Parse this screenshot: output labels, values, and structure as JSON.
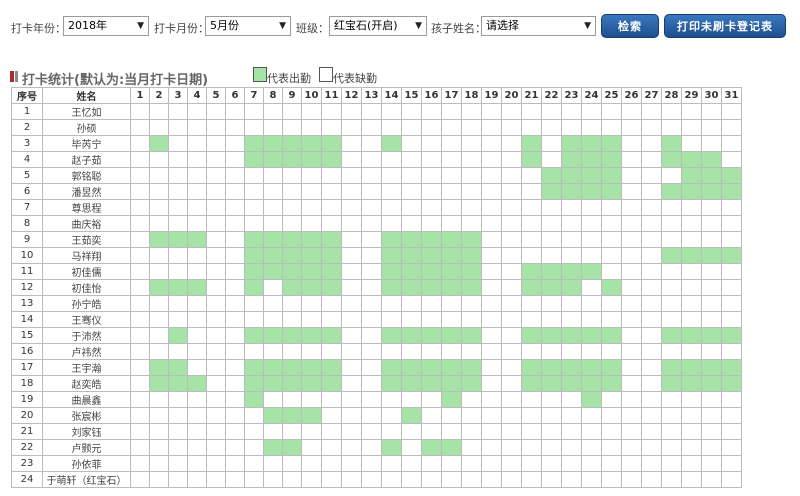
{
  "filters": {
    "year_label": "打卡年份：",
    "year_value": "2018年",
    "month_label": "打卡月份：",
    "month_value": "5月份",
    "class_label": "班级：",
    "class_value": "红宝石(开启)",
    "child_label": "孩子姓名：",
    "child_value": "请选择",
    "dropdown_arrow": "▼"
  },
  "buttons": {
    "search": "检索",
    "print": "打印未刷卡登记表"
  },
  "section": {
    "title": "打卡统计(默认为:当月打卡日期)"
  },
  "legend": {
    "present": "代表出勤",
    "absent": "代表缺勤",
    "present_color": "#a6e3a6",
    "absent_color": "#ffffff"
  },
  "table": {
    "headers": {
      "index": "序号",
      "name": "姓名"
    },
    "days": [
      "1",
      "2",
      "3",
      "4",
      "5",
      "6",
      "7",
      "8",
      "9",
      "10",
      "11",
      "12",
      "13",
      "14",
      "15",
      "16",
      "17",
      "18",
      "19",
      "20",
      "21",
      "22",
      "23",
      "24",
      "25",
      "26",
      "27",
      "28",
      "29",
      "30",
      "31"
    ],
    "rows": [
      {
        "no": "1",
        "name": "王忆如",
        "present": []
      },
      {
        "no": "2",
        "name": "孙硕",
        "present": []
      },
      {
        "no": "3",
        "name": "毕芮宁",
        "present": [
          2,
          7,
          8,
          9,
          10,
          11,
          14,
          21,
          23,
          24,
          25,
          28
        ]
      },
      {
        "no": "4",
        "name": "赵子茹",
        "present": [
          7,
          8,
          9,
          10,
          11,
          21,
          23,
          24,
          25,
          28,
          29,
          30
        ]
      },
      {
        "no": "5",
        "name": "郭铭聪",
        "present": [
          22,
          23,
          24,
          25,
          29,
          30,
          31
        ]
      },
      {
        "no": "6",
        "name": "潘昱然",
        "present": [
          22,
          23,
          24,
          25,
          28,
          29,
          30,
          31
        ]
      },
      {
        "no": "7",
        "name": "尊思程",
        "present": []
      },
      {
        "no": "8",
        "name": "曲庆裕",
        "present": []
      },
      {
        "no": "9",
        "name": "王茹奕",
        "present": [
          2,
          3,
          4,
          7,
          8,
          9,
          10,
          11,
          14,
          15,
          16,
          17,
          18
        ]
      },
      {
        "no": "10",
        "name": "马祥翔",
        "present": [
          7,
          8,
          9,
          10,
          11,
          14,
          15,
          16,
          17,
          18,
          28,
          29,
          30,
          31
        ]
      },
      {
        "no": "11",
        "name": "初佳儒",
        "present": [
          7,
          8,
          9,
          10,
          11,
          14,
          15,
          16,
          17,
          18,
          21,
          22,
          23,
          24
        ]
      },
      {
        "no": "12",
        "name": "初佳怡",
        "present": [
          2,
          3,
          4,
          7,
          9,
          10,
          11,
          14,
          15,
          16,
          17,
          18,
          21,
          22,
          23,
          25
        ]
      },
      {
        "no": "13",
        "name": "孙宁皓",
        "present": []
      },
      {
        "no": "14",
        "name": "王骞仪",
        "present": []
      },
      {
        "no": "15",
        "name": "于沛然",
        "present": [
          3,
          7,
          8,
          9,
          10,
          11,
          14,
          15,
          16,
          17,
          18,
          21,
          22,
          23,
          24,
          25,
          28,
          29,
          30,
          31
        ]
      },
      {
        "no": "16",
        "name": "卢祎然",
        "present": []
      },
      {
        "no": "17",
        "name": "王宇瀚",
        "present": [
          2,
          3,
          7,
          8,
          9,
          10,
          11,
          14,
          15,
          16,
          17,
          18,
          21,
          22,
          23,
          24,
          25,
          28,
          29,
          30,
          31
        ]
      },
      {
        "no": "18",
        "name": "赵奕皓",
        "present": [
          2,
          3,
          4,
          7,
          8,
          9,
          10,
          11,
          14,
          15,
          16,
          17,
          18,
          21,
          22,
          23,
          24,
          25,
          28,
          29,
          30,
          31
        ]
      },
      {
        "no": "19",
        "name": "曲晨鑫",
        "present": [
          7,
          17,
          24
        ]
      },
      {
        "no": "20",
        "name": "张宸彬",
        "present": [
          8,
          9,
          10,
          15
        ]
      },
      {
        "no": "21",
        "name": "刘家钰",
        "present": []
      },
      {
        "no": "22",
        "name": "卢颢元",
        "present": [
          8,
          9,
          14,
          16,
          17
        ]
      },
      {
        "no": "23",
        "name": "孙依菲",
        "present": []
      },
      {
        "no": "24",
        "name": "于萌轩（红宝石）",
        "present": []
      }
    ]
  }
}
